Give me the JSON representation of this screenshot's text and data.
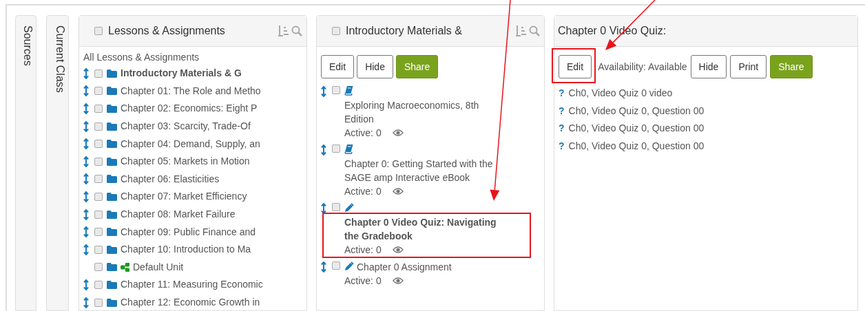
{
  "side_tabs": [
    {
      "label": "Sources"
    },
    {
      "label": "Current Class"
    }
  ],
  "lessons_panel": {
    "title": "Lessons & Assignments",
    "checked": false,
    "root_label": "All Lessons & Assignments",
    "items": [
      {
        "label": "Introductory Materials & G",
        "kind": "folder",
        "draggable": true,
        "checked": false,
        "selected": true
      },
      {
        "label": "Chapter 01: The Role and Metho",
        "kind": "folder",
        "draggable": true,
        "checked": false,
        "selected": false
      },
      {
        "label": "Chapter 02: Economics: Eight P",
        "kind": "folder",
        "draggable": true,
        "checked": false,
        "selected": false
      },
      {
        "label": "Chapter 03: Scarcity, Trade-Of",
        "kind": "folder",
        "draggable": true,
        "checked": false,
        "selected": false
      },
      {
        "label": "Chapter 04: Demand, Supply, an",
        "kind": "folder",
        "draggable": true,
        "checked": false,
        "selected": false
      },
      {
        "label": "Chapter 05: Markets in Motion",
        "kind": "folder",
        "draggable": true,
        "checked": false,
        "selected": false
      },
      {
        "label": "Chapter 06: Elasticities",
        "kind": "folder",
        "draggable": true,
        "checked": false,
        "selected": false
      },
      {
        "label": "Chapter 07: Market Efficiency",
        "kind": "folder",
        "draggable": true,
        "checked": false,
        "selected": false
      },
      {
        "label": "Chapter 08: Market Failure",
        "kind": "folder",
        "draggable": true,
        "checked": false,
        "selected": false
      },
      {
        "label": "Chapter 09: Public Finance and",
        "kind": "folder",
        "draggable": true,
        "checked": false,
        "selected": false
      },
      {
        "label": "Chapter 10: Introduction to Ma",
        "kind": "folder",
        "draggable": true,
        "checked": false,
        "selected": false
      },
      {
        "label": "Default Unit",
        "kind": "shared_folder",
        "draggable": false,
        "checked": false,
        "selected": false
      },
      {
        "label": "Chapter 11: Measuring Economic",
        "kind": "folder",
        "draggable": true,
        "checked": false,
        "selected": false
      },
      {
        "label": "Chapter 12: Economic Growth in",
        "kind": "folder",
        "draggable": true,
        "checked": false,
        "selected": false
      }
    ]
  },
  "unit_panel": {
    "title": "Introductory Materials &",
    "checked": false,
    "buttons": [
      {
        "label": "Edit",
        "kind": "default"
      },
      {
        "label": "Hide",
        "kind": "default"
      },
      {
        "label": "Share",
        "kind": "success"
      }
    ],
    "items": [
      {
        "kind": "book",
        "title": "Exploring Macroeconomics, 8th Edition",
        "status": "Active: 0",
        "checked": false,
        "selected": false,
        "highlighted": false
      },
      {
        "kind": "book",
        "title": "Chapter 0: Getting Started with the SAGE amp Interactive eBook",
        "status": "Active: 0",
        "checked": false,
        "selected": false,
        "highlighted": false
      },
      {
        "kind": "assignment",
        "title": "Chapter 0 Video Quiz: Navigating the Gradebook",
        "status": "Active: 0",
        "checked": false,
        "selected": true,
        "highlighted": true
      },
      {
        "kind": "assignment",
        "title": "Chapter 0 Assignment",
        "status": "Active: 0",
        "checked": false,
        "selected": false,
        "highlighted": false
      }
    ]
  },
  "detail_panel": {
    "title": "Chapter 0 Video Quiz:",
    "toolbar": [
      {
        "kind": "button",
        "label": "Edit",
        "highlighted": true
      },
      {
        "kind": "text",
        "label": "Availability: Available"
      },
      {
        "kind": "button",
        "label": "Hide",
        "highlighted": false
      },
      {
        "kind": "button",
        "label": "Print",
        "highlighted": false
      },
      {
        "kind": "success",
        "label": "Share",
        "highlighted": false
      }
    ],
    "questions": [
      {
        "marker": "?",
        "label": "Ch0, Video Quiz 0 video"
      },
      {
        "marker": "?",
        "label": "Ch0, Video Quiz 0, Question 00"
      },
      {
        "marker": "?",
        "label": "Ch0, Video Quiz 0, Question 00"
      },
      {
        "marker": "?",
        "label": "Ch0, Video Quiz 0, Question 00"
      }
    ]
  }
}
